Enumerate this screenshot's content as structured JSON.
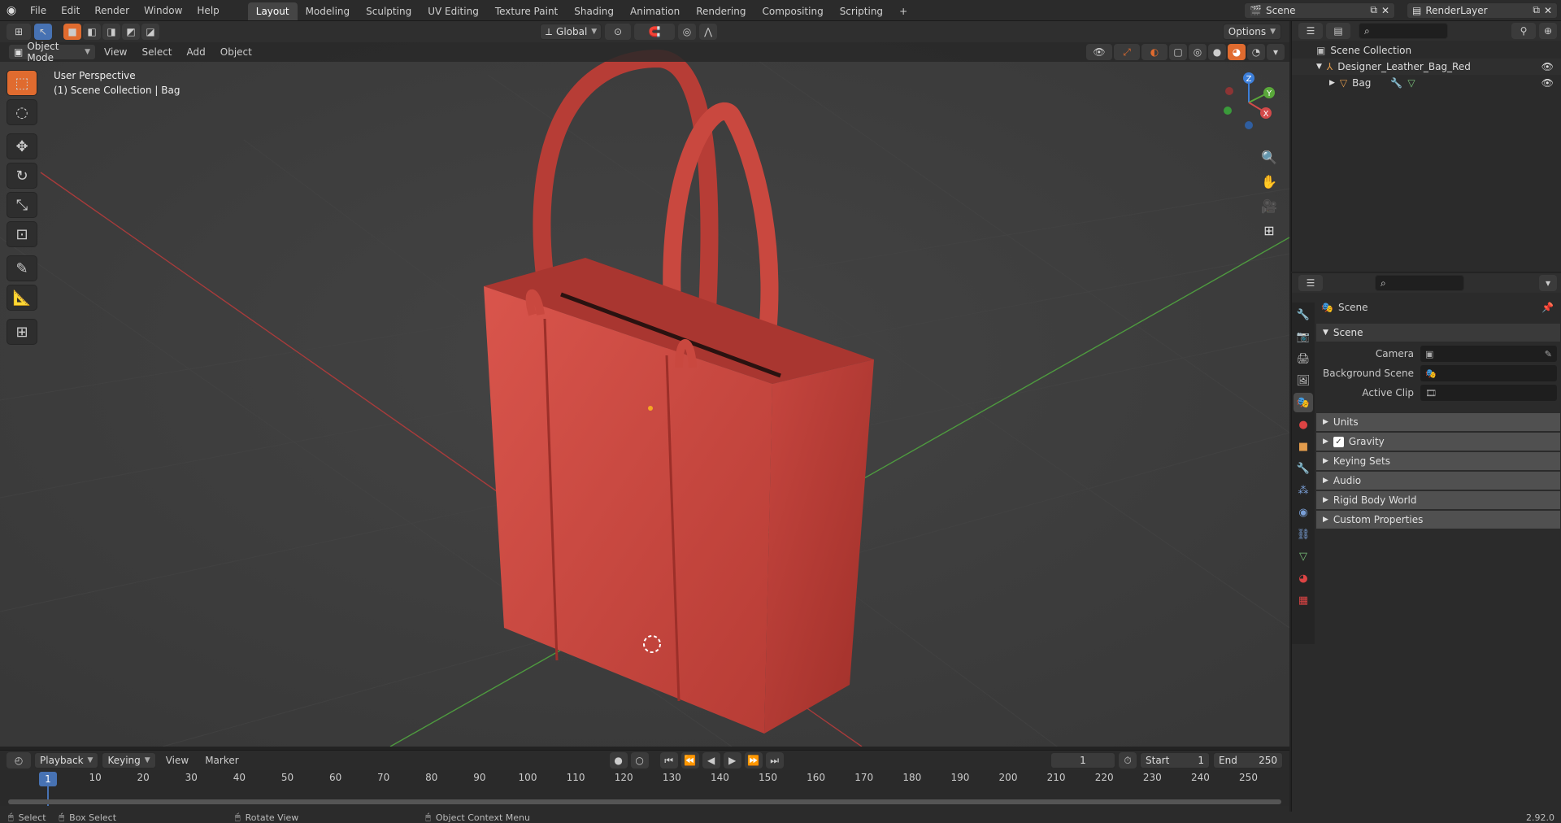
{
  "top_menu": [
    "File",
    "Edit",
    "Render",
    "Window",
    "Help"
  ],
  "workspaces": [
    "Layout",
    "Modeling",
    "Sculpting",
    "UV Editing",
    "Texture Paint",
    "Shading",
    "Animation",
    "Rendering",
    "Compositing",
    "Scripting"
  ],
  "active_workspace": "Layout",
  "add_workspace": "+",
  "scene_name": "Scene",
  "render_layer": "RenderLayer",
  "transform_orientation": "Global",
  "options_label": "Options",
  "viewport_header": {
    "mode": "Object Mode",
    "menus": [
      "View",
      "Select",
      "Add",
      "Object"
    ]
  },
  "viewport_overlay": {
    "perspective": "User Perspective",
    "collection": "(1) Scene Collection | Bag"
  },
  "gizmo_axes": {
    "x": "X",
    "y": "Y",
    "z": "Z"
  },
  "outliner": {
    "items": [
      {
        "label": "Scene Collection",
        "indent": 0
      },
      {
        "label": "Designer_Leather_Bag_Red",
        "indent": 1
      },
      {
        "label": "Bag",
        "indent": 2
      }
    ]
  },
  "properties": {
    "context": "Scene",
    "scene_panel": "Scene",
    "rows": [
      {
        "label": "Camera"
      },
      {
        "label": "Background Scene"
      },
      {
        "label": "Active Clip"
      }
    ],
    "subpanels": [
      {
        "label": "Units",
        "checkbox": false
      },
      {
        "label": "Gravity",
        "checkbox": true
      },
      {
        "label": "Keying Sets",
        "checkbox": false
      },
      {
        "label": "Audio",
        "checkbox": false
      },
      {
        "label": "Rigid Body World",
        "checkbox": false
      },
      {
        "label": "Custom Properties",
        "checkbox": false
      }
    ]
  },
  "timeline": {
    "menus": [
      "Playback",
      "Keying",
      "View",
      "Marker"
    ],
    "current_frame": "1",
    "start_label": "Start",
    "start": "1",
    "end_label": "End",
    "end": "250",
    "ticks": [
      "10",
      "20",
      "30",
      "40",
      "50",
      "60",
      "70",
      "80",
      "90",
      "100",
      "110",
      "120",
      "130",
      "140",
      "150",
      "160",
      "170",
      "180",
      "190",
      "200",
      "210",
      "220",
      "230",
      "240",
      "250"
    ],
    "cursor_label": "1"
  },
  "statusbar": {
    "select": "Select",
    "box_select": "Box Select",
    "rotate_view": "Rotate View",
    "context_menu": "Object Context Menu",
    "version": "2.92.0"
  },
  "colors": {
    "accent": "#4772b3",
    "bag": "#c8473f",
    "active_tool": "#e06b2f"
  }
}
